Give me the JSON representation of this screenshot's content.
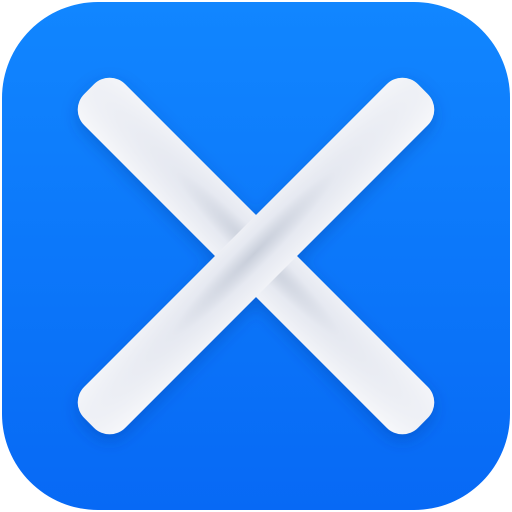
{
  "icon": {
    "name": "close-icon",
    "tile_color": "#0A7BFF",
    "tile_color_dark": "#0769F5",
    "glyph_color": "#F1F3F8",
    "glyph_shadow_color": "#C9CFDB"
  }
}
